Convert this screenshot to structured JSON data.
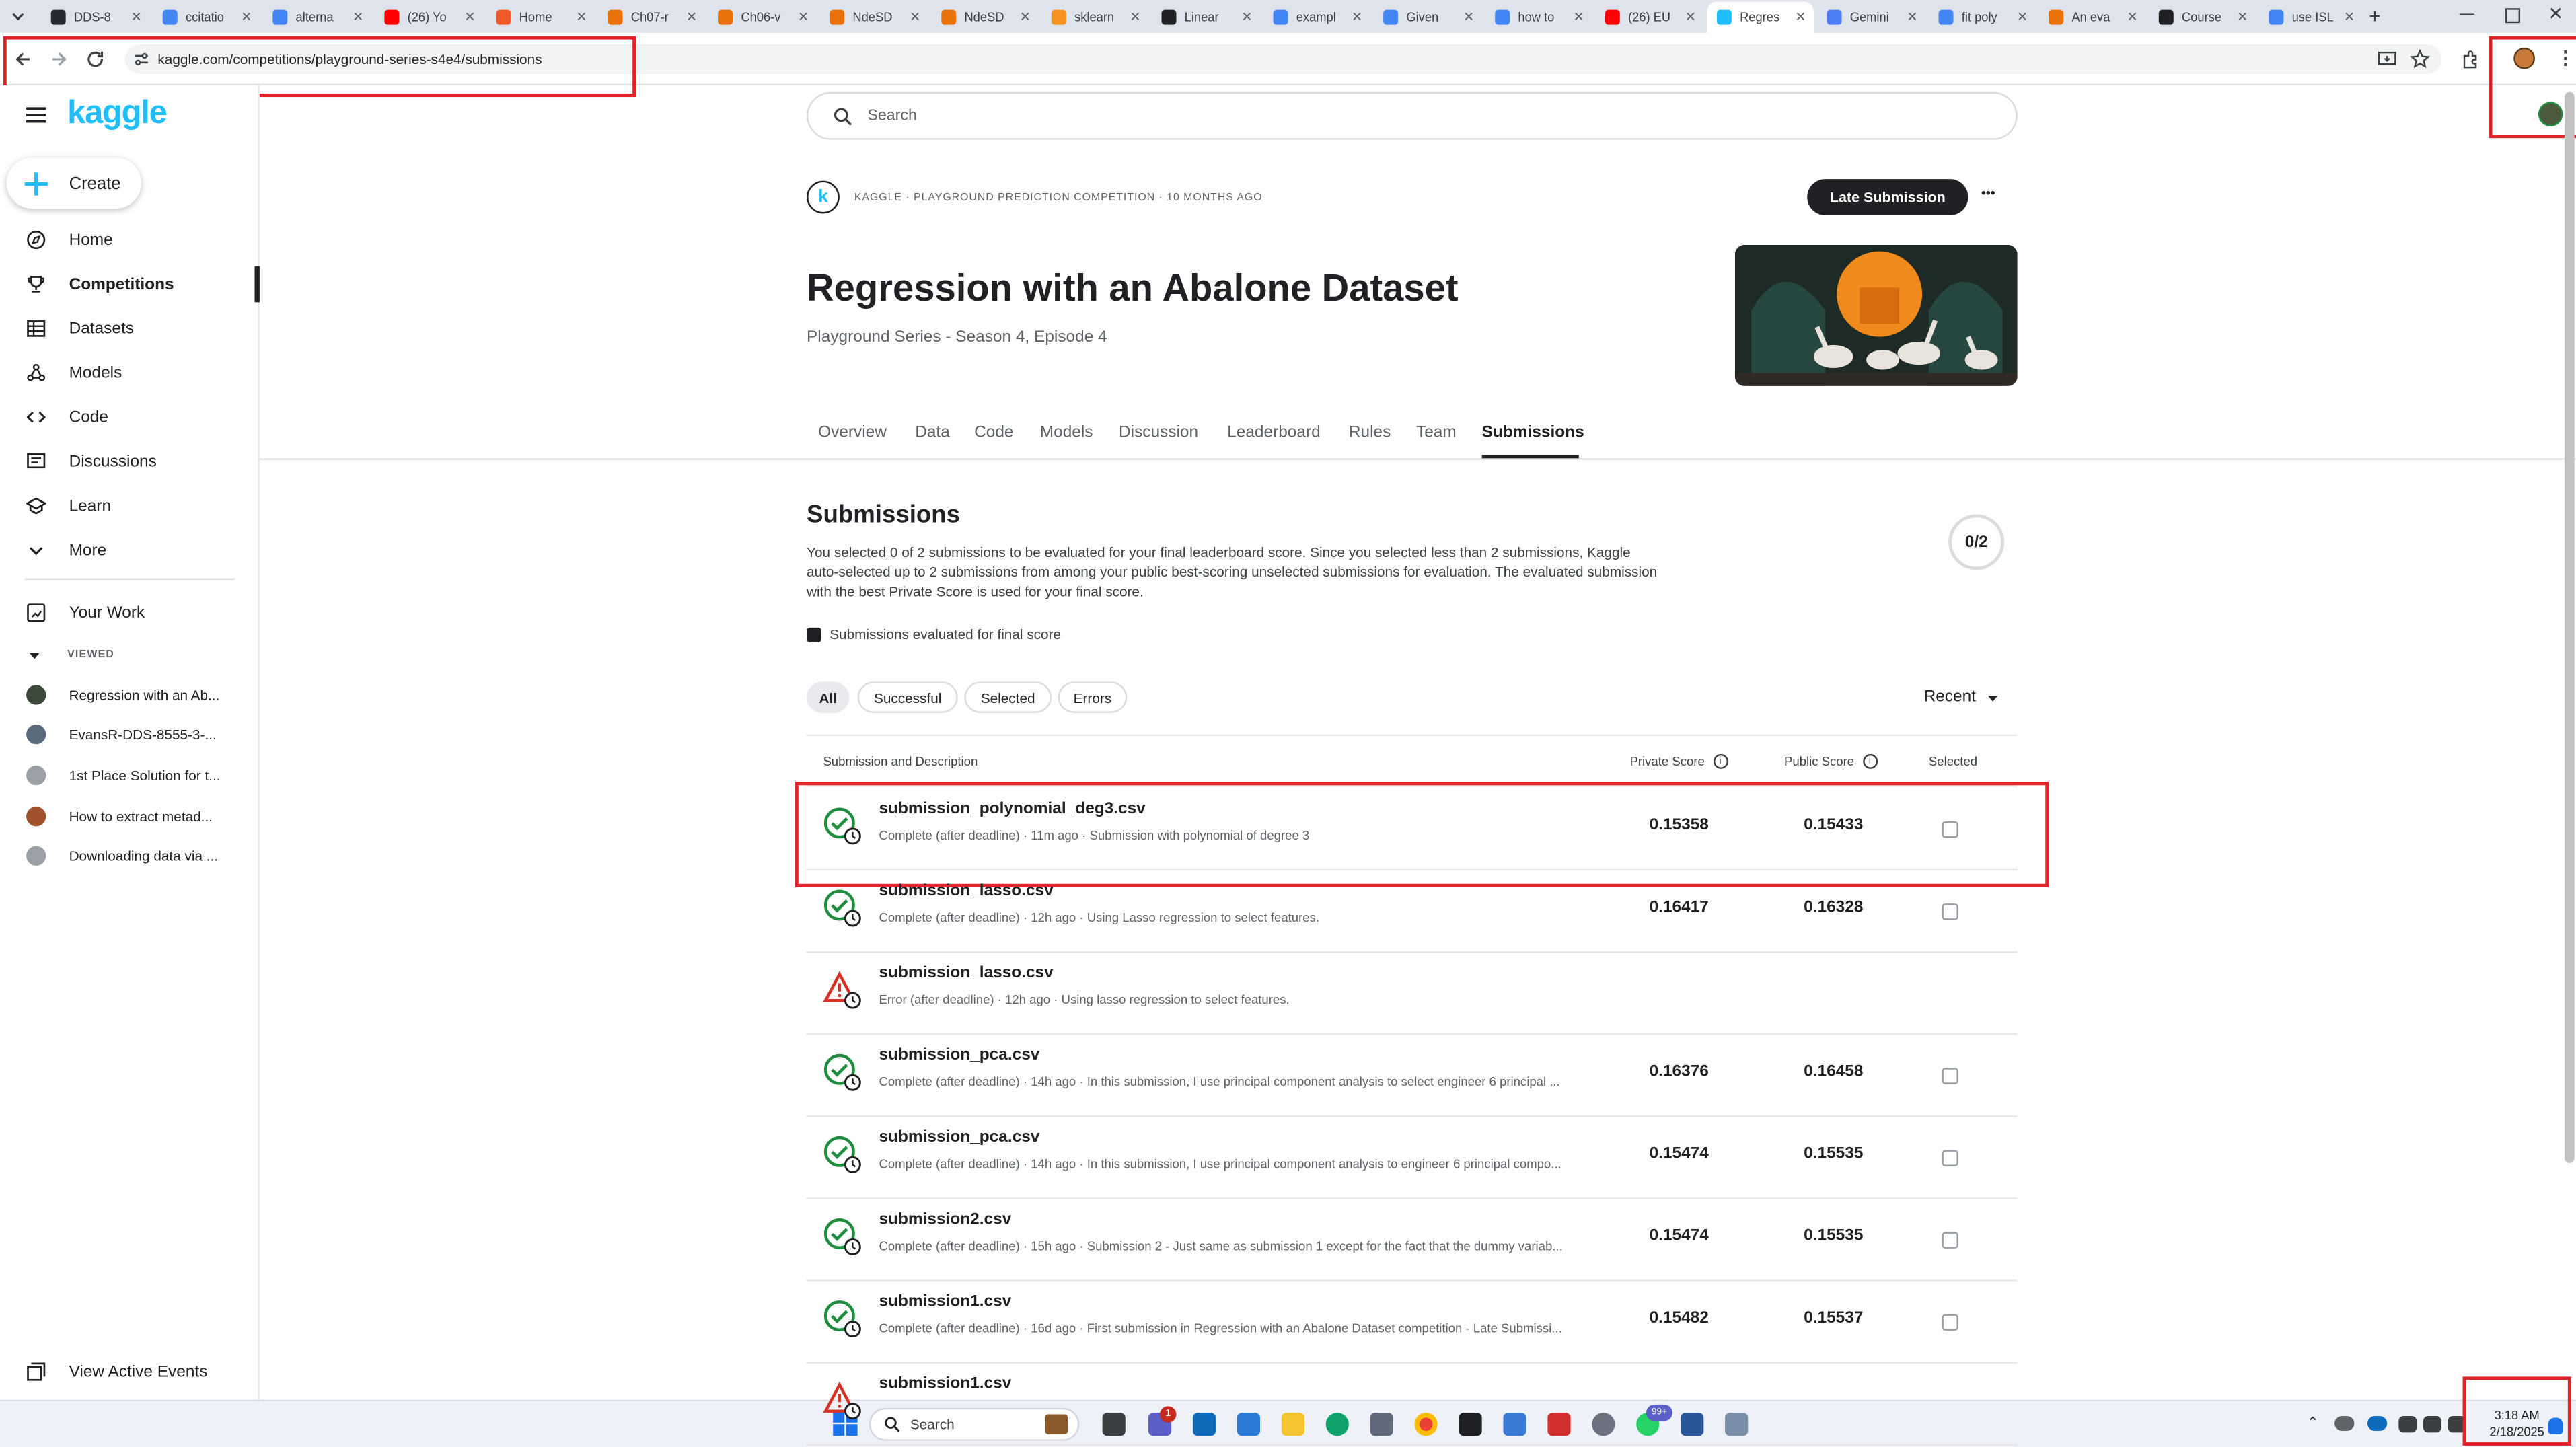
{
  "browser": {
    "tabs": [
      {
        "title": "DDS-8",
        "color": "#24292f"
      },
      {
        "title": "ccitatio",
        "color": "#4285f4"
      },
      {
        "title": "alterna",
        "color": "#4285f4"
      },
      {
        "title": "(26) Yo",
        "color": "#ff0000"
      },
      {
        "title": "Home",
        "color": "#f05a28"
      },
      {
        "title": "Ch07-r",
        "color": "#e8710a"
      },
      {
        "title": "Ch06-v",
        "color": "#e8710a"
      },
      {
        "title": "NdeSD",
        "color": "#e8710a"
      },
      {
        "title": "NdeSD",
        "color": "#e8710a"
      },
      {
        "title": "sklearn",
        "color": "#f7931e"
      },
      {
        "title": "Linear",
        "color": "#202124"
      },
      {
        "title": "exampl",
        "color": "#4285f4"
      },
      {
        "title": "Given",
        "color": "#4285f4"
      },
      {
        "title": "how to",
        "color": "#4285f4"
      },
      {
        "title": "(26) EU",
        "color": "#ff0000"
      },
      {
        "title": "Regres",
        "color": "#20beff"
      },
      {
        "title": "Gemini",
        "color": "#4e7cf6"
      },
      {
        "title": "fit poly",
        "color": "#4285f4"
      },
      {
        "title": "An eva",
        "color": "#e8710a"
      },
      {
        "title": "Course",
        "color": "#202124"
      },
      {
        "title": "use ISL",
        "color": "#4285f4"
      }
    ],
    "new_tab": "+",
    "url": "kaggle.com/competitions/playground-series-s4e4/submissions"
  },
  "sidebar": {
    "logo": "kaggle",
    "create_label": "Create",
    "nav": [
      {
        "label": "Home",
        "icon": "compass-icon"
      },
      {
        "label": "Competitions",
        "icon": "trophy-icon"
      },
      {
        "label": "Datasets",
        "icon": "table-icon"
      },
      {
        "label": "Models",
        "icon": "models-icon"
      },
      {
        "label": "Code",
        "icon": "code-icon"
      },
      {
        "label": "Discussions",
        "icon": "discussion-icon"
      },
      {
        "label": "Learn",
        "icon": "school-icon"
      },
      {
        "label": "More",
        "icon": "chevron-down-icon"
      }
    ],
    "your_work": "Your Work",
    "viewed_header": "VIEWED",
    "viewed": [
      {
        "label": "Regression with an Ab...",
        "color": "#3c4a3a"
      },
      {
        "label": "EvansR-DDS-8555-3-...",
        "color": "#5a6b7c"
      },
      {
        "label": "1st Place Solution for t...",
        "color": "#9aa0a6"
      },
      {
        "label": "How to extract metad...",
        "color": "#a0522d"
      },
      {
        "label": "Downloading data via ...",
        "color": "#9aa0a6"
      }
    ],
    "view_active_events": "View Active Events"
  },
  "search": {
    "placeholder": "Search"
  },
  "competition": {
    "meta": "KAGGLE · PLAYGROUND PREDICTION COMPETITION · 10 MONTHS AGO",
    "late_submission": "Late Submission",
    "more": "•••",
    "title": "Regression with an Abalone Dataset",
    "subtitle": "Playground Series - Season 4, Episode 4"
  },
  "tabs": [
    "Overview",
    "Data",
    "Code",
    "Models",
    "Discussion",
    "Leaderboard",
    "Rules",
    "Team",
    "Submissions"
  ],
  "submissions": {
    "heading": "Submissions",
    "description": "You selected 0 of 2 submissions to be evaluated for your final leaderboard score. Since you selected less than 2 submissions, Kaggle auto-selected up to 2 submissions from among your public best-scoring unselected submissions for evaluation. The evaluated submission with the best Private Score is used for your final score.",
    "counter": "0/2",
    "legend": "Submissions evaluated for final score",
    "filters": [
      "All",
      "Successful",
      "Selected",
      "Errors"
    ],
    "sort": "Recent",
    "columns": {
      "desc": "Submission and Description",
      "private": "Private Score",
      "public": "Public Score",
      "selected": "Selected"
    },
    "rows": [
      {
        "file": "submission_polynomial_deg3.csv",
        "desc": "Complete (after deadline) · 11m ago · Submission with polynomial of degree 3",
        "private": "0.15358",
        "public": "0.15433",
        "status": "complete"
      },
      {
        "file": "submission_lasso.csv",
        "desc": "Complete (after deadline) · 12h ago · Using Lasso regression to select features.",
        "private": "0.16417",
        "public": "0.16328",
        "status": "complete"
      },
      {
        "file": "submission_lasso.csv",
        "desc": "Error (after deadline) · 12h ago · Using lasso regression to select features.",
        "private": "",
        "public": "",
        "status": "error"
      },
      {
        "file": "submission_pca.csv",
        "desc": "Complete (after deadline) · 14h ago · In this submission, I use principal component analysis to select engineer 6 principal ...",
        "private": "0.16376",
        "public": "0.16458",
        "status": "complete"
      },
      {
        "file": "submission_pca.csv",
        "desc": "Complete (after deadline) · 14h ago · In this submission, I use principal component analysis to engineer 6 principal compo...",
        "private": "0.15474",
        "public": "0.15535",
        "status": "complete"
      },
      {
        "file": "submission2.csv",
        "desc": "Complete (after deadline) · 15h ago · Submission 2 - Just same as submission 1 except for the fact that the dummy variab...",
        "private": "0.15474",
        "public": "0.15535",
        "status": "complete"
      },
      {
        "file": "submission1.csv",
        "desc": "Complete (after deadline) · 16d ago · First submission in Regression with an Abalone Dataset competition - Late Submissi...",
        "private": "0.15482",
        "public": "0.15537",
        "status": "complete"
      },
      {
        "file": "submission1.csv",
        "desc": "",
        "private": "",
        "public": "",
        "status": "error"
      }
    ]
  },
  "taskbar": {
    "search": "Search",
    "time": "3:18 AM",
    "date": "2/18/2025",
    "badge_teams": "1",
    "badge_whatsapp": "99+"
  }
}
